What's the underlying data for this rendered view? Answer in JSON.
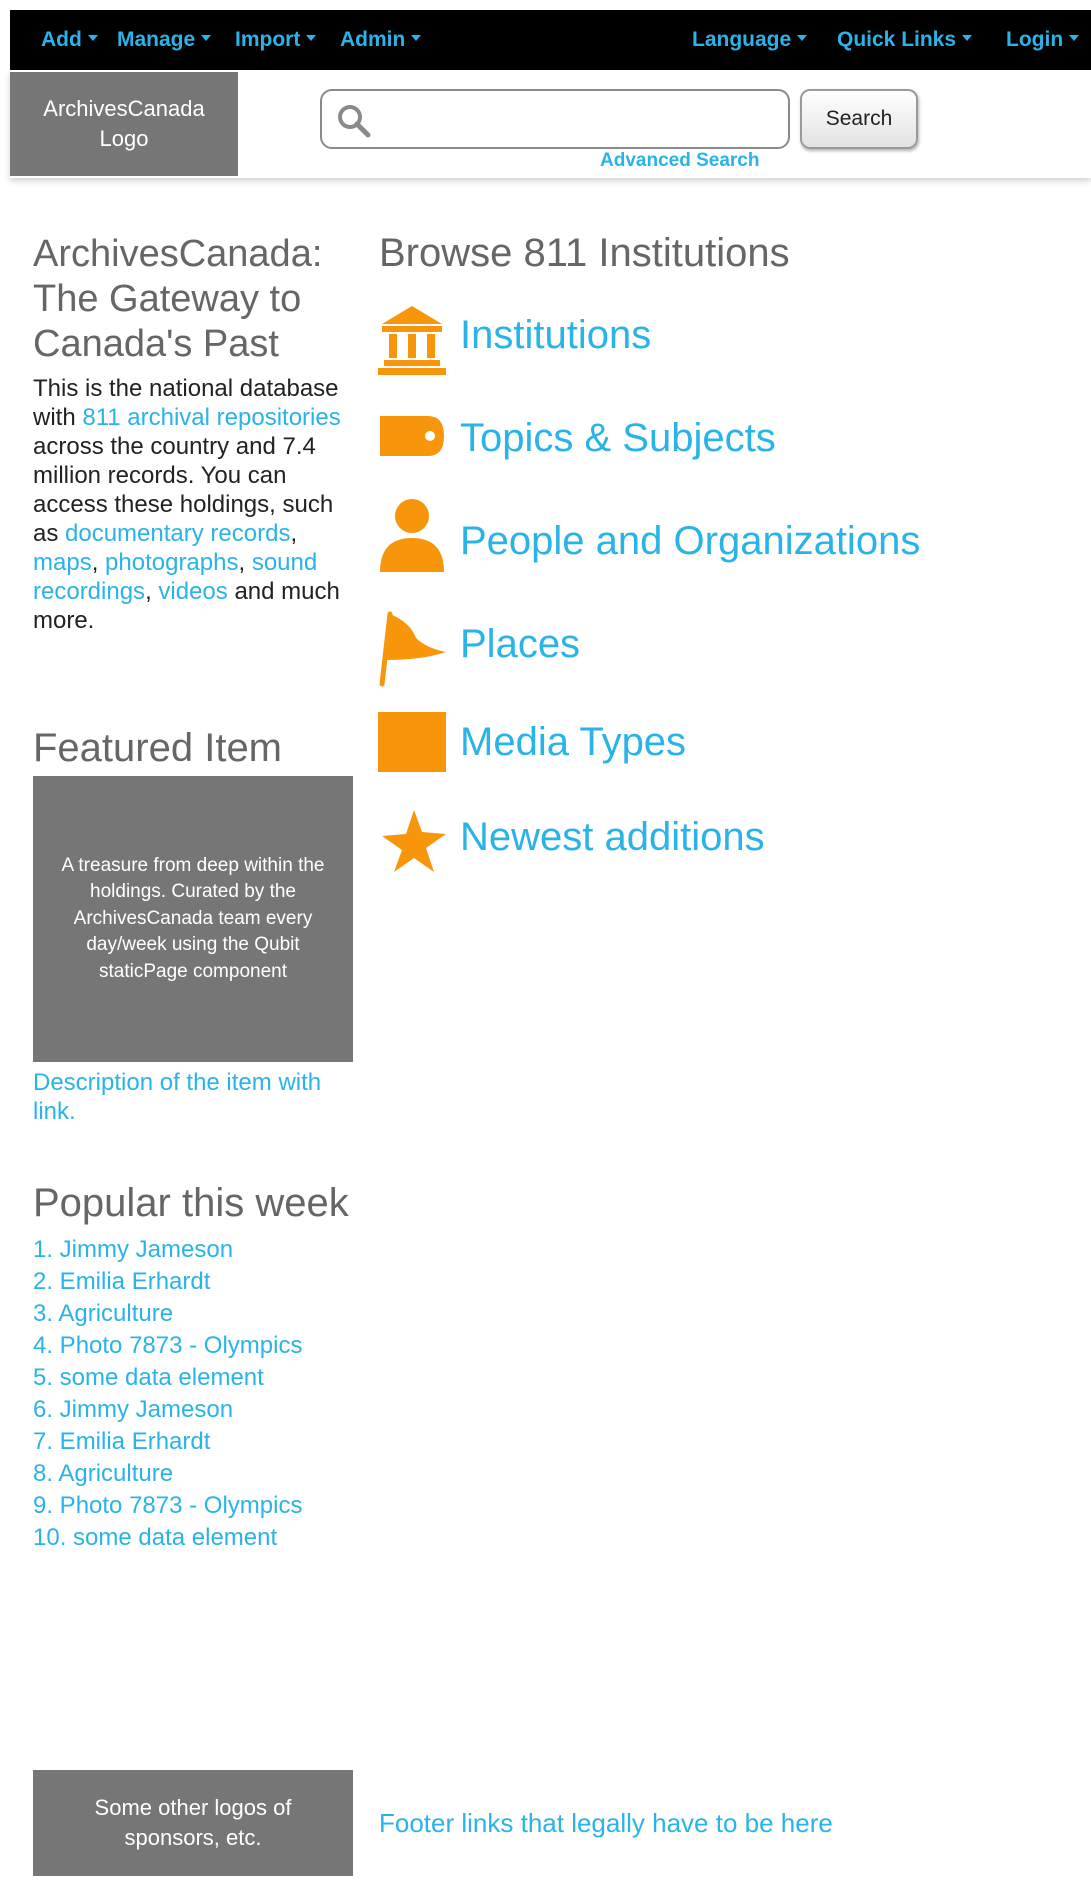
{
  "nav": {
    "left": [
      {
        "label": "Add"
      },
      {
        "label": "Manage"
      },
      {
        "label": "Import"
      },
      {
        "label": "Admin"
      }
    ],
    "right": [
      {
        "label": "Language"
      },
      {
        "label": "Quick Links"
      },
      {
        "label": "Login"
      }
    ]
  },
  "header": {
    "logo_text": "ArchivesCanada Logo",
    "search_placeholder": "",
    "search_button": "Search",
    "advanced_search": "Advanced Search"
  },
  "intro": {
    "title": "ArchivesCanada: The Gateway to Canada's Past",
    "text_1": "This is the national database with ",
    "link_repositories": "811 archival repositories",
    "text_2": " across the country and 7.4 million records. You can access these holdings, such as ",
    "link_documentary": "documentary records",
    "sep_1": ", ",
    "link_maps": "maps",
    "sep_2": ", ",
    "link_photographs": "photographs",
    "sep_3": ", ",
    "link_sound": "sound recordings",
    "sep_4": ", ",
    "link_videos": "videos",
    "text_3": " and much more."
  },
  "featured": {
    "title": "Featured Item",
    "box_text": "A treasure from deep within the holdings. Curated by the ArchivesCanada team every day/week using the Qubit staticPage component",
    "description_link": "Description of the item with link."
  },
  "popular": {
    "title": "Popular this week",
    "items": [
      "1. Jimmy Jameson",
      "2. Emilia Erhardt",
      "3. Agriculture",
      "4. Photo 7873 - Olympics",
      "5. some data element",
      "6. Jimmy Jameson",
      "7. Emilia Erhardt",
      "8. Agriculture",
      "9. Photo 7873 - Olympics",
      "10. some data element"
    ]
  },
  "browse": {
    "title": "Browse 811 Institutions",
    "items": [
      {
        "label": "Institutions",
        "icon": "institution-icon"
      },
      {
        "label": "Topics & Subjects",
        "icon": "tag-icon"
      },
      {
        "label": "People and Organizations",
        "icon": "person-icon"
      },
      {
        "label": "Places",
        "icon": "flag-icon"
      },
      {
        "label": "Media Types",
        "icon": "media-square-icon"
      },
      {
        "label": "Newest additions",
        "icon": "star-icon"
      }
    ]
  },
  "footer": {
    "sponsor_text": "Some other logos of sponsors, etc.",
    "links_text": "Footer links that legally have to be here"
  },
  "colors": {
    "topbar": "#000000",
    "link": "#2ab3e8",
    "icon_orange": "#f7960b",
    "placeholder_gray": "#767676",
    "heading_gray": "#666666"
  }
}
